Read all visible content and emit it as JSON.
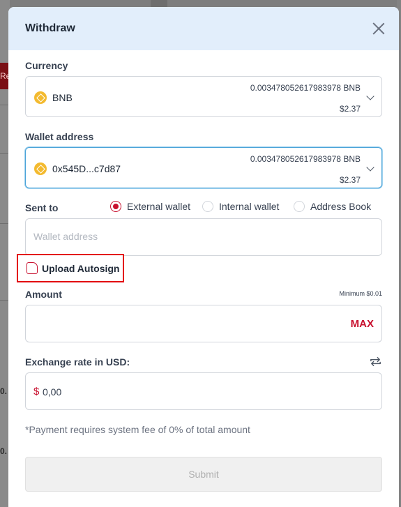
{
  "background": {
    "button_fragment": "Re",
    "row_fragment_1": "0.",
    "row_fragment_2": "0."
  },
  "modal": {
    "title": "Withdraw",
    "close_icon": "close-icon"
  },
  "currency": {
    "label": "Currency",
    "selected": {
      "name": "BNB",
      "icon": "bnb-coin-icon",
      "balance": "0.003478052617983978 BNB",
      "usd": "$2.37"
    }
  },
  "wallet": {
    "label": "Wallet address",
    "selected": {
      "name": "0x545D...c7d87",
      "icon": "bnb-coin-icon",
      "balance": "0.003478052617983978 BNB",
      "usd": "$2.37"
    }
  },
  "sent_to": {
    "label": "Sent to",
    "options": [
      {
        "label": "External wallet",
        "selected": true
      },
      {
        "label": "Internal wallet",
        "selected": false
      },
      {
        "label": "Address Book",
        "selected": false
      }
    ],
    "input_placeholder": "Wallet address",
    "input_value": ""
  },
  "upload": {
    "label": "Upload Autosign",
    "icon": "file-icon"
  },
  "amount": {
    "label": "Amount",
    "minimum": "Minimum $0.01",
    "value": "",
    "max_label": "MAX"
  },
  "exchange": {
    "label": "Exchange rate in USD:",
    "currency_symbol": "$",
    "value": "0,00",
    "swap_icon": "swap-icon"
  },
  "fee_note": "*Payment requires system fee of 0% of total amount",
  "submit_label": "Submit",
  "colors": {
    "accent": "#c8102e",
    "header_bg": "#e2eefb",
    "highlight_border": "#e3000f"
  }
}
